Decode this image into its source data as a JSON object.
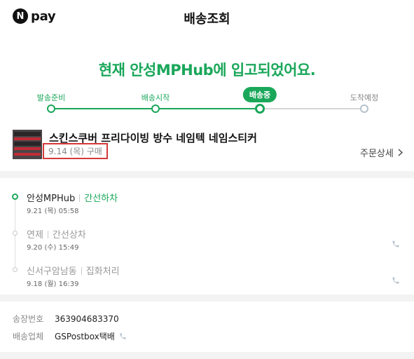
{
  "header": {
    "logo_letter": "N",
    "logo_text": "pay",
    "title": "배송조회"
  },
  "status_message": "현재 안성MPHub에 입고되었어요.",
  "stepper": {
    "steps": [
      {
        "label": "발송준비",
        "state": "done"
      },
      {
        "label": "배송시작",
        "state": "done"
      },
      {
        "label": "배송중",
        "state": "current"
      },
      {
        "label": "도착예정",
        "state": "todo"
      }
    ]
  },
  "product": {
    "name": "스킨스쿠버 프리다이빙 방수 네임텍 네임스티커",
    "purchase_date": "9.14 (목) 구매",
    "order_detail_label": "주문상세"
  },
  "timeline": [
    {
      "place": "안성MPHub",
      "status": "간선하차",
      "time": "9.21 (목) 05:58",
      "active": true,
      "has_phone": false
    },
    {
      "place": "연제",
      "status": "간선상차",
      "time": "9.20 (수) 15:49",
      "active": false,
      "has_phone": true
    },
    {
      "place": "신서구암남동",
      "status": "집화처리",
      "time": "9.18 (월) 16:39",
      "active": false,
      "has_phone": true
    }
  ],
  "shipping_info": {
    "tracking_label": "송장번호",
    "tracking_number": "363904683370",
    "carrier_label": "배송업체",
    "carrier_name": "GSPostbox택배"
  },
  "colors": {
    "accent": "#1aa75a",
    "highlight_box": "#d43a3a",
    "divider": "#f3f3f3"
  },
  "icons": {
    "phone": "phone-icon",
    "chevron": "chevron-right-icon"
  }
}
